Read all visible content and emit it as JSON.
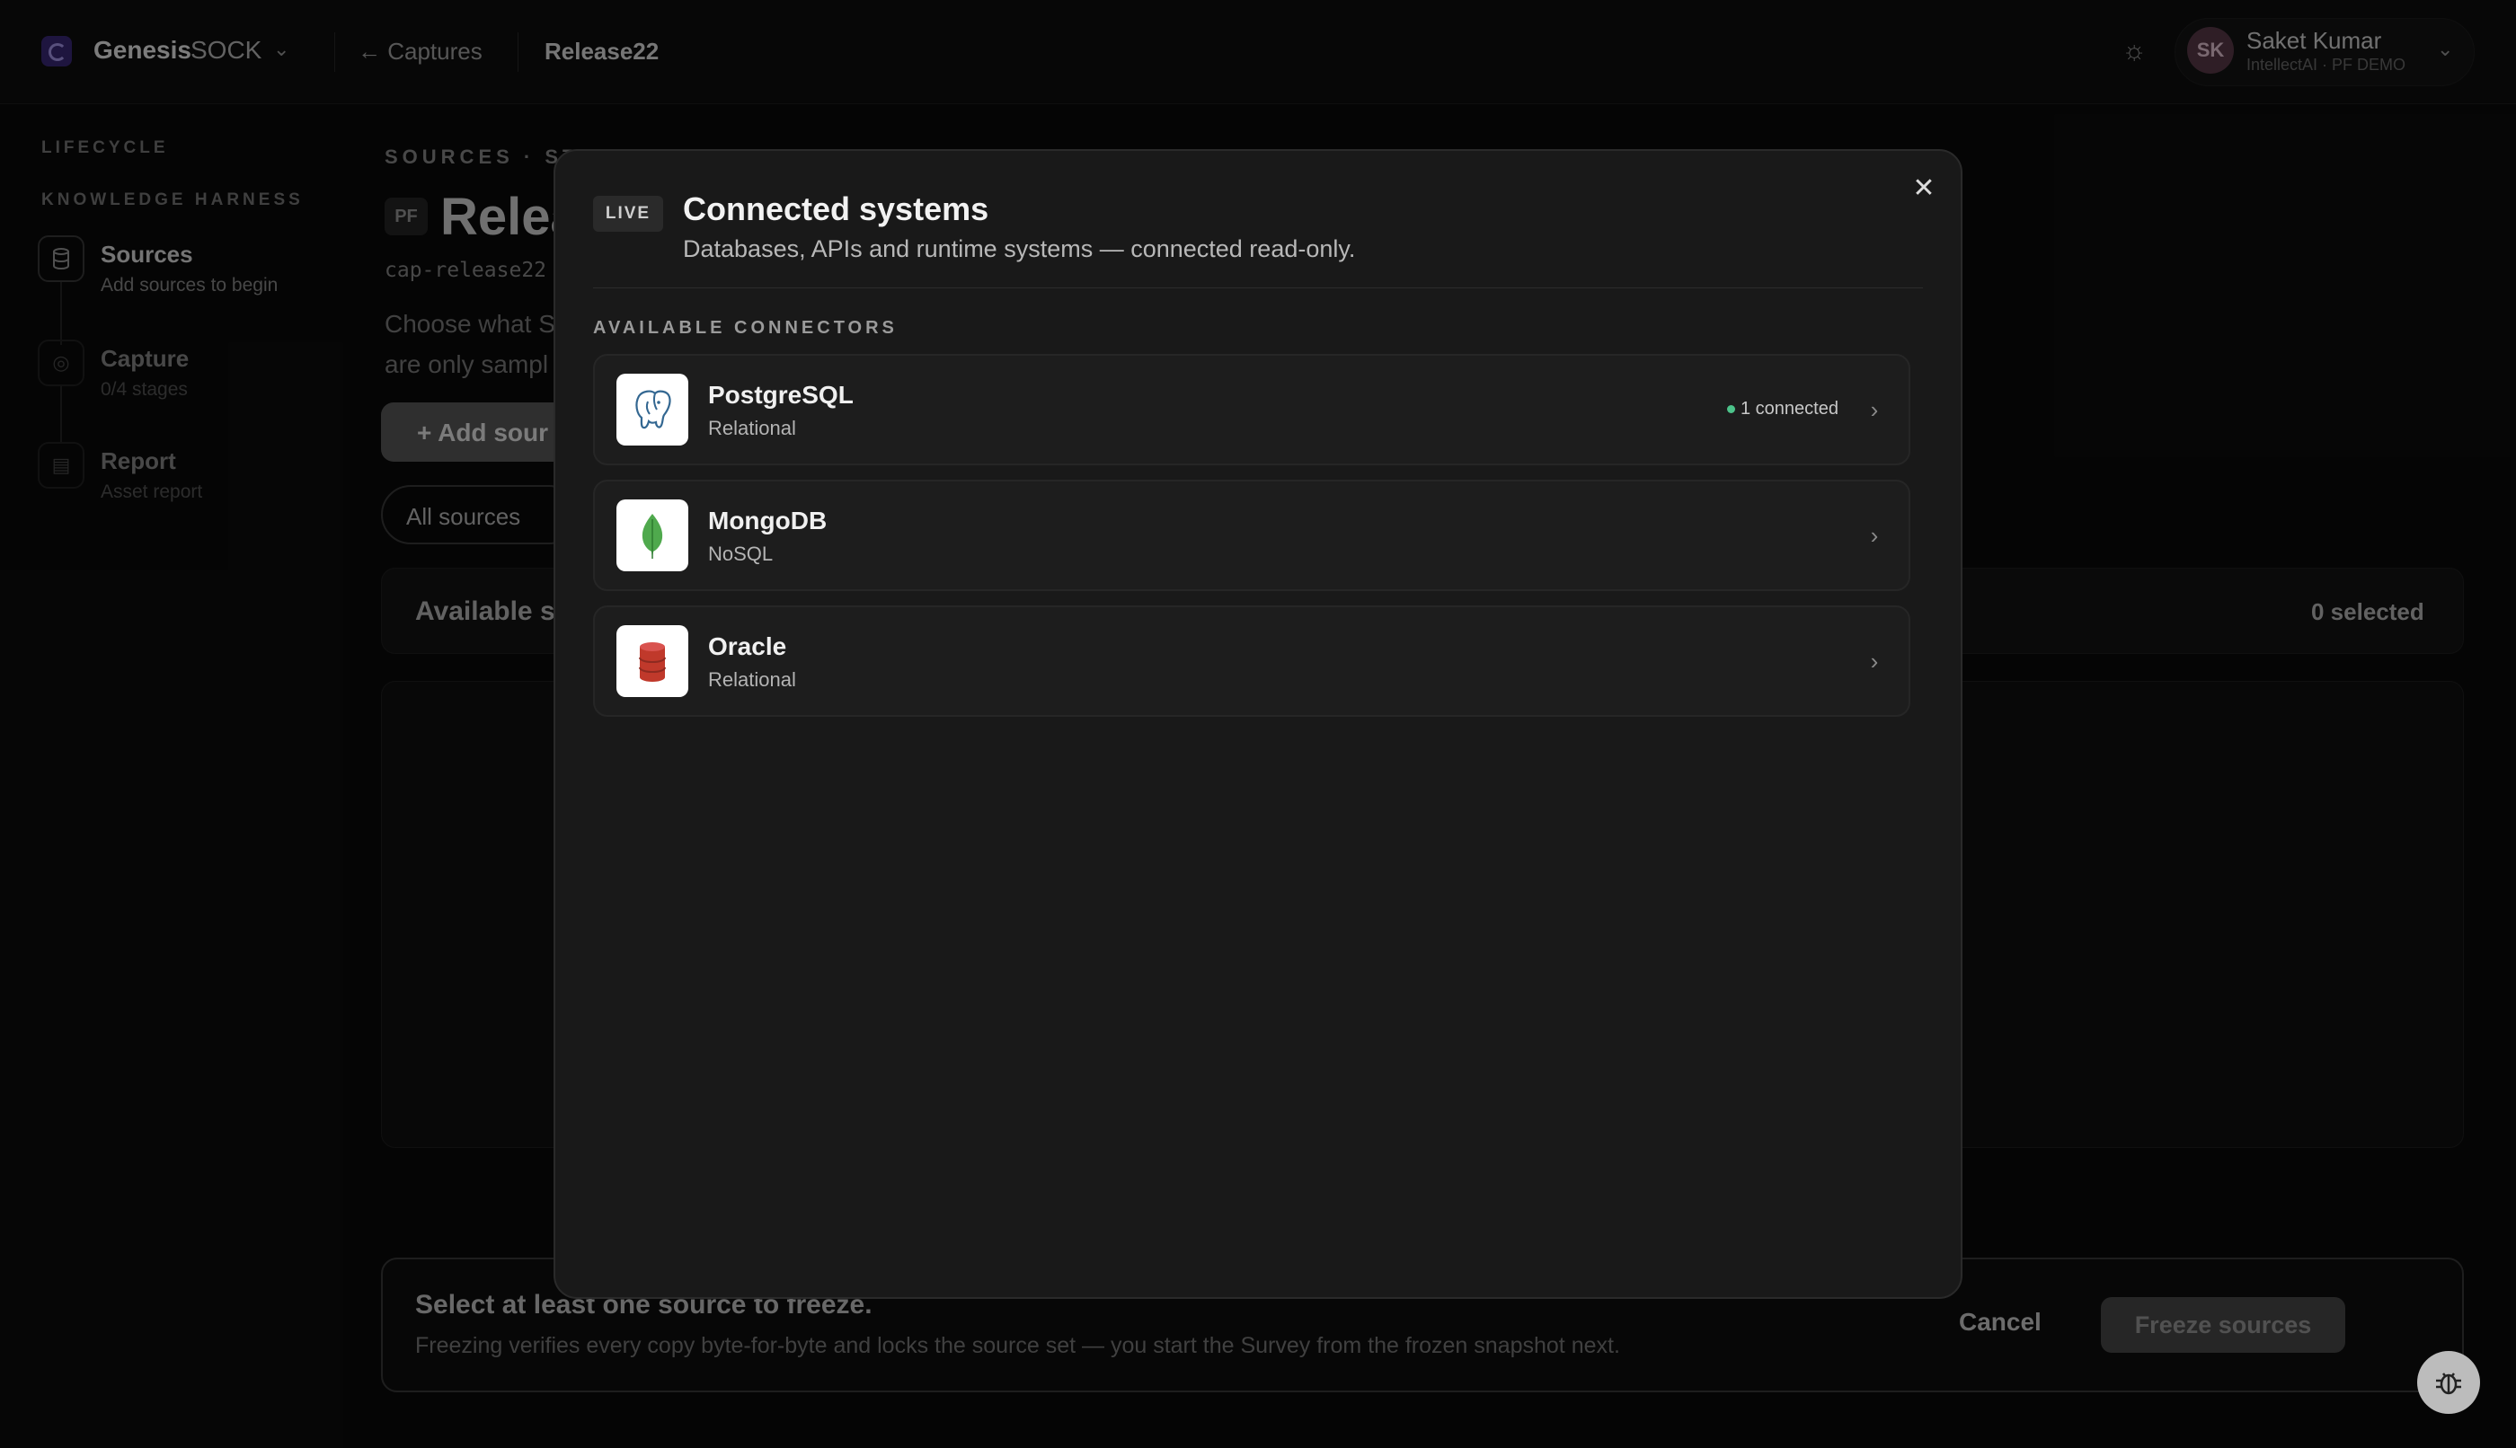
{
  "topbar": {
    "brand_name": "Genesis",
    "brand_product": "SOCK",
    "back_label": "Captures",
    "current_crumb": "Release22",
    "user": {
      "initials": "SK",
      "name": "Saket Kumar",
      "org": "IntellectAI · PF DEMO"
    }
  },
  "sidebar": {
    "section_lifecycle": "LIFECYCLE",
    "section_harness": "KNOWLEDGE HARNESS",
    "items": [
      {
        "title": "Sources",
        "subtitle": "Add sources to begin",
        "icon": "database-icon"
      },
      {
        "title": "Capture",
        "subtitle": "0/4 stages",
        "icon": "target-icon"
      },
      {
        "title": "Report",
        "subtitle": "Asset report",
        "icon": "document-icon"
      }
    ]
  },
  "main": {
    "kicker": "SOURCES · STA",
    "badge": "PF",
    "title": "Relea",
    "code": "cap-release22",
    "desc_line1": "Choose what S",
    "desc_line2": "are only sampl",
    "add_button": "Add sour",
    "filter_all": "All sources",
    "available_title": "Available s",
    "selected_count": "0 selected",
    "bottom_title": "Select at least one source to freeze.",
    "bottom_sub": "Freezing verifies every copy byte-for-byte and locks the source set — you start the Survey from the frozen snapshot next.",
    "cancel_label": "Cancel",
    "freeze_label": "Freeze sources"
  },
  "modal": {
    "badge": "LIVE",
    "title": "Connected systems",
    "subtitle": "Databases, APIs and runtime systems — connected read-only.",
    "section_label": "AVAILABLE CONNECTORS",
    "connectors": [
      {
        "name": "PostgreSQL",
        "type": "Relational",
        "status": "1 connected",
        "icon": "postgresql-elephant-icon"
      },
      {
        "name": "MongoDB",
        "type": "NoSQL",
        "status": "",
        "icon": "mongodb-leaf-icon"
      },
      {
        "name": "Oracle",
        "type": "Relational",
        "status": "",
        "icon": "oracle-database-icon"
      }
    ]
  },
  "colors": {
    "accent_live": "#4cc38a",
    "modal_bg": "#191919",
    "page_bg": "#0b0b0b"
  }
}
